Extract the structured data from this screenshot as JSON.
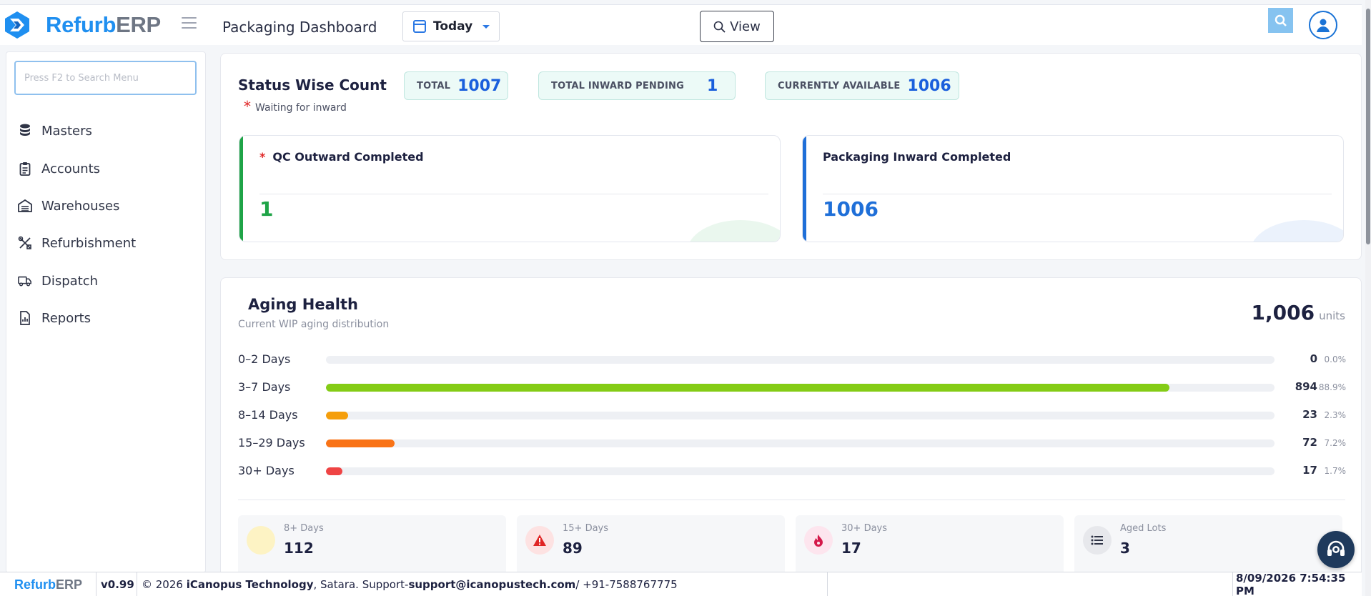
{
  "app": {
    "logo_part1": "Refurb",
    "logo_part2": "ERP",
    "page_title": "Packaging Dashboard",
    "date_filter": "Today",
    "view_button": "View"
  },
  "sidebar": {
    "search_placeholder": "Press F2 to Search Menu",
    "items": [
      {
        "label": "Masters",
        "icon": "database-icon"
      },
      {
        "label": "Accounts",
        "icon": "clipboard-icon"
      },
      {
        "label": "Warehouses",
        "icon": "warehouse-icon"
      },
      {
        "label": "Refurbishment",
        "icon": "tools-icon"
      },
      {
        "label": "Dispatch",
        "icon": "truck-icon"
      },
      {
        "label": "Reports",
        "icon": "report-icon"
      }
    ]
  },
  "status": {
    "title": "Status Wise Count",
    "note": "Waiting for inward",
    "pills": [
      {
        "label": "TOTAL",
        "value": "1007"
      },
      {
        "label": "TOTAL INWARD PENDING",
        "value": "1"
      },
      {
        "label": "CURRENTLY AVAILABLE",
        "value": "1006"
      }
    ],
    "cards": [
      {
        "title": "QC Outward Completed",
        "value": "1",
        "accent": "#1fa447"
      },
      {
        "title": "Packaging Inward Completed",
        "value": "1006",
        "accent": "#1f6fd8"
      }
    ]
  },
  "aging": {
    "title": "Aging Health",
    "subtitle": "Current WIP aging distribution",
    "total": "1,006",
    "total_unit": "units",
    "rows": [
      {
        "label": "0–2 Days",
        "count": "0",
        "pct": "0.0%",
        "fraction": 0.0,
        "color": "#22c55e"
      },
      {
        "label": "3–7 Days",
        "count": "894",
        "pct": "88.9%",
        "fraction": 0.889,
        "color": "#84cc16"
      },
      {
        "label": "8–14 Days",
        "count": "23",
        "pct": "2.3%",
        "fraction": 0.023,
        "color": "#f59e0b"
      },
      {
        "label": "15–29 Days",
        "count": "72",
        "pct": "7.2%",
        "fraction": 0.072,
        "color": "#f97316"
      },
      {
        "label": "30+ Days",
        "count": "17",
        "pct": "1.7%",
        "fraction": 0.017,
        "color": "#ef4444"
      }
    ],
    "summary": [
      {
        "label": "8+ Days",
        "value": "112",
        "icon": "clock-icon"
      },
      {
        "label": "15+ Days",
        "value": "89",
        "icon": "warning-icon"
      },
      {
        "label": "30+ Days",
        "value": "17",
        "icon": "fire-icon"
      },
      {
        "label": "Aged Lots",
        "value": "3",
        "icon": "list-icon"
      }
    ]
  },
  "footer": {
    "brand_part1": "Refurb",
    "brand_part2": "ERP",
    "version": "v0.99",
    "copyright": "© 2026",
    "company": "iCanopus Technology",
    "location": ", Satara. Support-",
    "email": "support@icanopustech.com",
    "phone": " / +91-7588767775",
    "datetime": "8/09/2026 7:54:35 PM"
  }
}
